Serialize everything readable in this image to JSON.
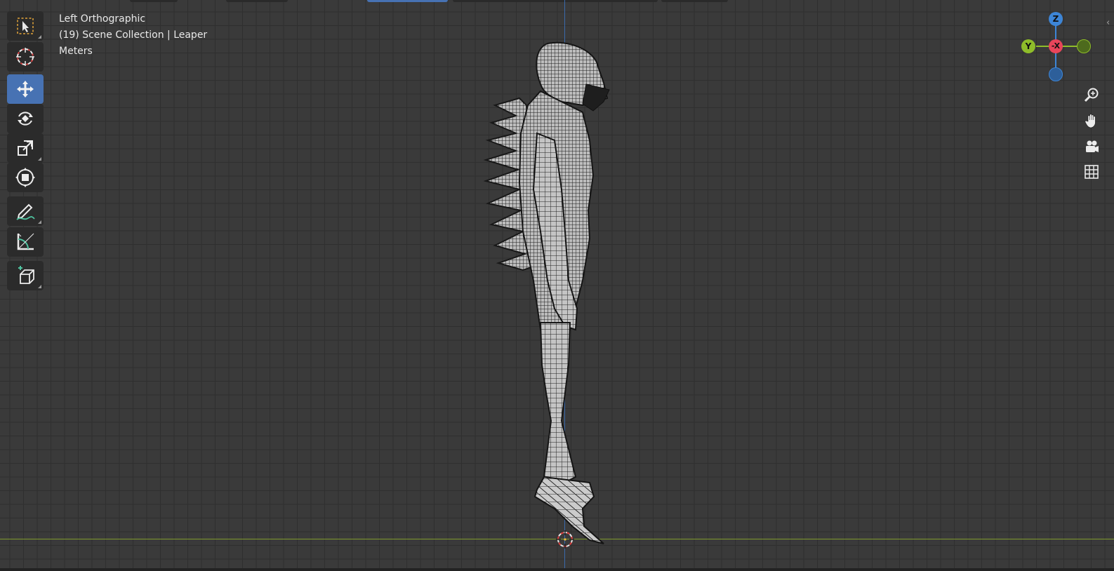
{
  "viewport": {
    "view_name": "Left Orthographic",
    "collection_line": "(19) Scene Collection | Leaper",
    "units": "Meters"
  },
  "gizmo": {
    "z_label": "Z",
    "y_label": "Y",
    "x_label": "-X",
    "colors": {
      "z": "#3d85d6",
      "y": "#8fbd2a",
      "x": "#e8455a",
      "z_neg": "#2d5f9a",
      "y_neg": "#4d6a1d"
    }
  },
  "toolbar": {
    "tools": [
      {
        "name": "select-box",
        "icon": "select-box-icon",
        "active": false
      },
      {
        "name": "cursor",
        "icon": "cursor-icon",
        "active": false
      },
      {
        "name": "move",
        "icon": "move-icon",
        "active": true
      },
      {
        "name": "rotate",
        "icon": "rotate-icon",
        "active": false
      },
      {
        "name": "scale",
        "icon": "scale-icon",
        "active": false
      },
      {
        "name": "transform",
        "icon": "transform-icon",
        "active": false
      },
      {
        "name": "annotate",
        "icon": "annotate-icon",
        "active": false
      },
      {
        "name": "measure",
        "icon": "measure-icon",
        "active": false
      },
      {
        "name": "add-cube",
        "icon": "add-cube-icon",
        "active": false
      }
    ]
  },
  "navigation": {
    "buttons": [
      "zoom-icon",
      "pan-hand-icon",
      "camera-icon",
      "grid-icon"
    ]
  },
  "axis_colors": {
    "z_axis_line": "#3b6fb8",
    "y_axis_line": "#7f9b2d",
    "active_tool": "#4772b3"
  }
}
